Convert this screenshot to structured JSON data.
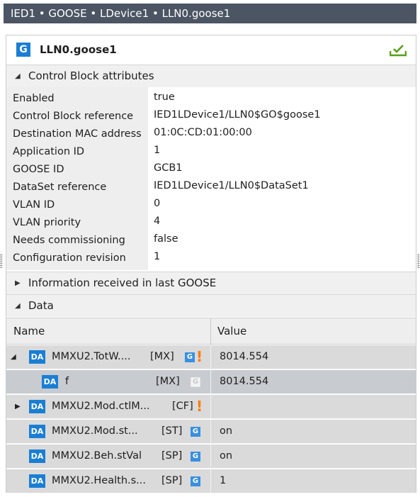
{
  "breadcrumb": "IED1 • GOOSE • LDevice1 • LLN0.goose1",
  "header": {
    "badge": "G",
    "title": "LLN0.goose1"
  },
  "sections": {
    "control_block": "Control Block attributes",
    "last_goose": "Information received in last GOOSE",
    "data": "Data"
  },
  "attributes": [
    {
      "name": "Enabled",
      "value": "true"
    },
    {
      "name": "Control Block reference",
      "value": "IED1LDevice1/LLN0$GO$goose1"
    },
    {
      "name": "Destination MAC address",
      "value": "01:0C:CD:01:00:00"
    },
    {
      "name": "Application ID",
      "value": "1"
    },
    {
      "name": "GOOSE ID",
      "value": "GCB1"
    },
    {
      "name": "DataSet reference",
      "value": "IED1LDevice1/LLN0$DataSet1"
    },
    {
      "name": "VLAN ID",
      "value": "0"
    },
    {
      "name": "VLAN priority",
      "value": "4"
    },
    {
      "name": "Needs commissioning",
      "value": "false"
    },
    {
      "name": "Configuration revision",
      "value": "1"
    }
  ],
  "grid": {
    "col_name": "Name",
    "col_value": "Value",
    "rows": [
      {
        "badge": "DA",
        "name": "MMXU2.TotW....",
        "fc": "[MX]",
        "g": "G",
        "value": "8014.554"
      },
      {
        "badge": "DA",
        "name": "f",
        "fc": "[MX]",
        "g": "G",
        "value": "8014.554"
      },
      {
        "badge": "DA",
        "name": "MMXU2.Mod.ctlM...",
        "fc": "[CF]",
        "value": ""
      },
      {
        "badge": "DA",
        "name": "MMXU2.Mod.st...",
        "fc": "[ST]",
        "g": "G",
        "value": "on"
      },
      {
        "badge": "DA",
        "name": "MMXU2.Beh.stVal",
        "fc": "[SP]",
        "g": "G",
        "value": "on"
      },
      {
        "badge": "DA",
        "name": "MMXU2.Health.s...",
        "fc": "[SP]",
        "g": "G",
        "value": "1"
      }
    ]
  },
  "icons": {
    "expanded": "triangle-down-icon",
    "collapsed": "triangle-right-icon",
    "warning": "exclamation-icon",
    "checkmark": "checkmark-tray-icon"
  },
  "colors": {
    "accent": "#1a7fd4",
    "warning": "#ff7b00",
    "check": "#5a9e1a",
    "titlebar": "#4b5563"
  },
  "glyphs": {
    "down": "◢",
    "right": "▶",
    "excl": "!"
  }
}
